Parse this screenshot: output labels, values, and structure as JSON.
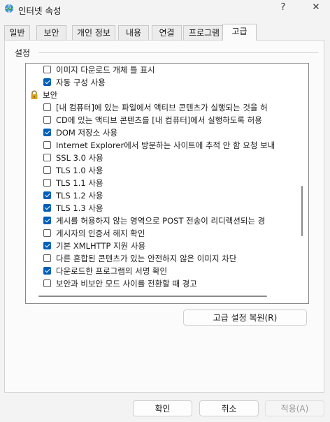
{
  "window": {
    "title": "인터넷 속성",
    "help_label": "?",
    "close_label": "✕"
  },
  "tabs": [
    {
      "label": "일반"
    },
    {
      "label": "보안"
    },
    {
      "label": "개인 정보"
    },
    {
      "label": "내용"
    },
    {
      "label": "연결"
    },
    {
      "label": "프로그램"
    },
    {
      "label": "고급",
      "active": true
    }
  ],
  "settings": {
    "group_label": "설정",
    "items": [
      {
        "type": "checkbox",
        "checked": false,
        "label": "이미지 다운로드 개체 틀 표시"
      },
      {
        "type": "checkbox",
        "checked": true,
        "label": "자동 구성 사용"
      },
      {
        "type": "heading",
        "icon": "lock-icon",
        "label": "보안"
      },
      {
        "type": "checkbox",
        "checked": false,
        "label": "[내 컴퓨터]에 있는 파일에서 액티브 콘텐츠가 실행되는 것을 허"
      },
      {
        "type": "checkbox",
        "checked": false,
        "label": "CD에 있는 액티브 콘텐츠를 [내 컴퓨터]에서 실행하도록 허용"
      },
      {
        "type": "checkbox",
        "checked": true,
        "label": "DOM 저장소 사용"
      },
      {
        "type": "checkbox",
        "checked": false,
        "label": "Internet Explorer에서 방문하는 사이트에 추적 안 함 요청 보내"
      },
      {
        "type": "checkbox",
        "checked": false,
        "label": "SSL 3.0 사용"
      },
      {
        "type": "checkbox",
        "checked": false,
        "label": "TLS 1.0 사용"
      },
      {
        "type": "checkbox",
        "checked": false,
        "label": "TLS 1.1 사용"
      },
      {
        "type": "checkbox",
        "checked": true,
        "label": "TLS 1.2 사용"
      },
      {
        "type": "checkbox",
        "checked": true,
        "label": "TLS 1.3 사용"
      },
      {
        "type": "checkbox",
        "checked": true,
        "label": "게시를 허용하지 않는 영역으로 POST 전송이 리디렉션되는 경"
      },
      {
        "type": "checkbox",
        "checked": false,
        "label": "게시자의 인증서 해지 확인"
      },
      {
        "type": "checkbox",
        "checked": true,
        "label": "기본 XMLHTTP 지원 사용"
      },
      {
        "type": "checkbox",
        "checked": false,
        "label": "다른 혼합된 콘텐츠가 있는 안전하지 않은 이미지 차단"
      },
      {
        "type": "checkbox",
        "checked": true,
        "label": "다운로드한 프로그램의 서명 확인"
      },
      {
        "type": "checkbox",
        "checked": false,
        "label": "보안과 비보안 모드 사이를 전환할 때 경고"
      }
    ],
    "restore_label": "고급 설정 복원(R)"
  },
  "footer": {
    "ok_label": "확인",
    "cancel_label": "취소",
    "apply_label": "적용(A)"
  },
  "colors": {
    "accent": "#005fb8",
    "lock_gold": "#d9a21b"
  }
}
